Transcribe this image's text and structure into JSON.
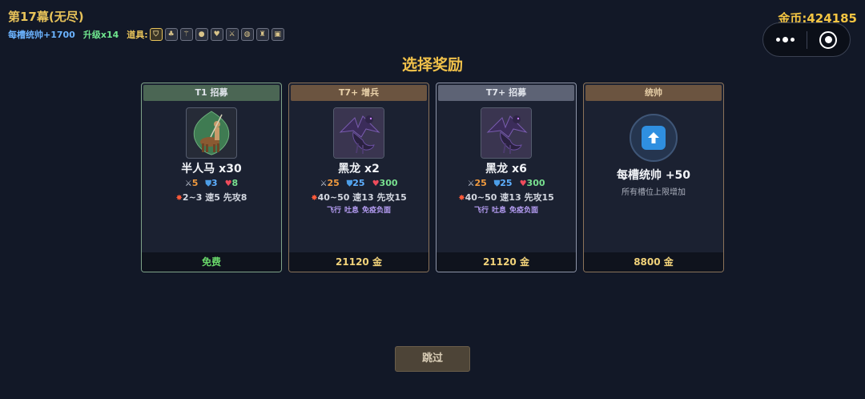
{
  "header": {
    "stage_title": "第17幕(无尽)",
    "per_slot_command": "每槽统帅+1700",
    "upgrade": "升级x14",
    "items_label": "道具:",
    "items": [
      {
        "icon": "shield-item-icon",
        "glyph": "⛉"
      },
      {
        "icon": "pouch-item-icon",
        "glyph": "♣"
      },
      {
        "icon": "wand-item-icon",
        "glyph": "⚚"
      },
      {
        "icon": "orb-item-icon",
        "glyph": "●"
      },
      {
        "icon": "heart-gem-item-icon",
        "glyph": "♥"
      },
      {
        "icon": "dagger-item-icon",
        "glyph": "⚔"
      },
      {
        "icon": "round-shield-item-icon",
        "glyph": "◍"
      },
      {
        "icon": "armor-item-icon",
        "glyph": "♜"
      },
      {
        "icon": "tome-item-icon",
        "glyph": "▣"
      }
    ],
    "gold": "金币:424185"
  },
  "heading": "选择奖励",
  "cards": [
    {
      "tag": "T1 招募",
      "name": "半人马 x30",
      "atk": "5",
      "def": "3",
      "hp": "8",
      "dmg": "2~3",
      "speed": "速5",
      "initiative": "先攻8",
      "traits": [],
      "price": "免费"
    },
    {
      "tag": "T7+ 增兵",
      "name": "黑龙 x2",
      "atk": "25",
      "def": "25",
      "hp": "300",
      "dmg": "40~50",
      "speed": "速13",
      "initiative": "先攻15",
      "traits": [
        "飞行",
        "吐息",
        "免疫负面"
      ],
      "price": "21120 金"
    },
    {
      "tag": "T7+ 招募",
      "name": "黑龙 x6",
      "atk": "25",
      "def": "25",
      "hp": "300",
      "dmg": "40~50",
      "speed": "速13",
      "initiative": "先攻15",
      "traits": [
        "飞行",
        "吐息",
        "免疫负面"
      ],
      "price": "21120 金"
    },
    {
      "tag": "统帅",
      "name": "每槽统帅 +50",
      "desc": "所有槽位上限增加",
      "price": "8800 金"
    }
  ],
  "skip_label": "跳过",
  "colors": {
    "gold": "#f4c542",
    "heading": "#f1c14a",
    "free": "#69d86a",
    "trait": "#b49cf2"
  }
}
